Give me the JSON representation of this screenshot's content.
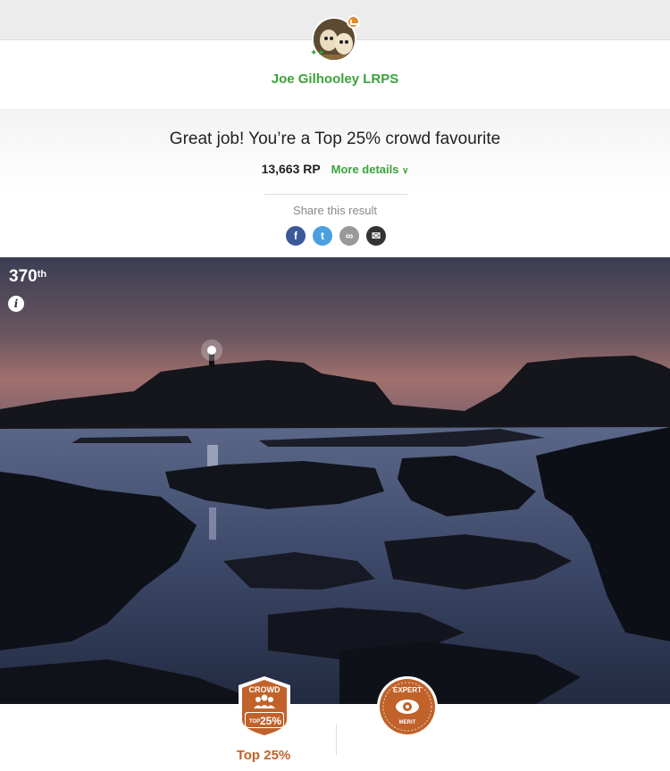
{
  "user": {
    "name": "Joe Gilhooley LRPS"
  },
  "result": {
    "headline": "Great job! You’re a Top 25% crowd favourite",
    "points": "13,663 RP",
    "more_details": "More details",
    "share_label": "Share this result"
  },
  "share": [
    {
      "icon": "facebook-icon",
      "glyph": "f",
      "color": "#3b5998"
    },
    {
      "icon": "twitter-icon",
      "glyph": "t",
      "color": "#4a9fe0"
    },
    {
      "icon": "link-icon",
      "glyph": "∞",
      "color": "#999999"
    },
    {
      "icon": "email-icon",
      "glyph": "✉",
      "color": "#333333"
    }
  ],
  "photo": {
    "rank_number": "370",
    "rank_suffix": "th"
  },
  "badges": {
    "crowd": {
      "title": "CROWD",
      "small": "TOP",
      "value": "25%",
      "label": "Top 25%"
    },
    "expert": {
      "title": "EXPERT",
      "sub": "MERIT"
    }
  },
  "colors": {
    "accent_green": "#3aa33a",
    "badge_orange": "#c0622a"
  }
}
